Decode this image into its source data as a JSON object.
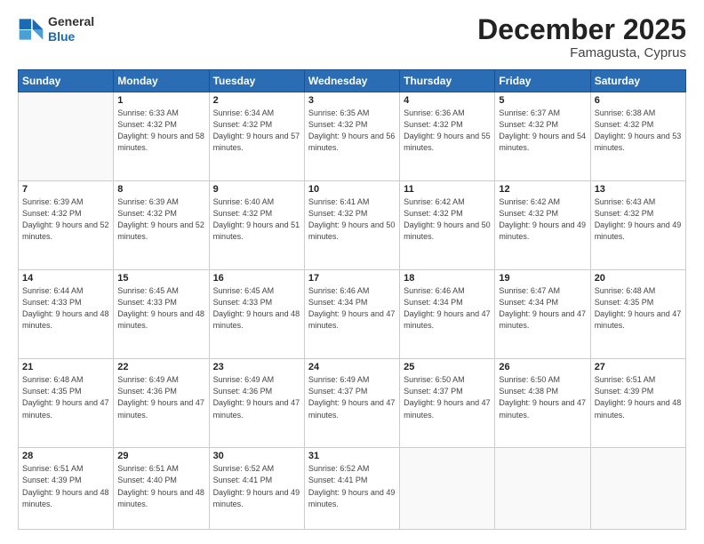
{
  "header": {
    "logo": {
      "general": "General",
      "blue": "Blue"
    },
    "title": "December 2025",
    "location": "Famagusta, Cyprus"
  },
  "calendar": {
    "days_of_week": [
      "Sunday",
      "Monday",
      "Tuesday",
      "Wednesday",
      "Thursday",
      "Friday",
      "Saturday"
    ],
    "weeks": [
      [
        {
          "num": "",
          "empty": true
        },
        {
          "num": "1",
          "sunrise": "6:33 AM",
          "sunset": "4:32 PM",
          "daylight": "9 hours and 58 minutes."
        },
        {
          "num": "2",
          "sunrise": "6:34 AM",
          "sunset": "4:32 PM",
          "daylight": "9 hours and 57 minutes."
        },
        {
          "num": "3",
          "sunrise": "6:35 AM",
          "sunset": "4:32 PM",
          "daylight": "9 hours and 56 minutes."
        },
        {
          "num": "4",
          "sunrise": "6:36 AM",
          "sunset": "4:32 PM",
          "daylight": "9 hours and 55 minutes."
        },
        {
          "num": "5",
          "sunrise": "6:37 AM",
          "sunset": "4:32 PM",
          "daylight": "9 hours and 54 minutes."
        },
        {
          "num": "6",
          "sunrise": "6:38 AM",
          "sunset": "4:32 PM",
          "daylight": "9 hours and 53 minutes."
        }
      ],
      [
        {
          "num": "7",
          "sunrise": "6:39 AM",
          "sunset": "4:32 PM",
          "daylight": "9 hours and 52 minutes."
        },
        {
          "num": "8",
          "sunrise": "6:39 AM",
          "sunset": "4:32 PM",
          "daylight": "9 hours and 52 minutes."
        },
        {
          "num": "9",
          "sunrise": "6:40 AM",
          "sunset": "4:32 PM",
          "daylight": "9 hours and 51 minutes."
        },
        {
          "num": "10",
          "sunrise": "6:41 AM",
          "sunset": "4:32 PM",
          "daylight": "9 hours and 50 minutes."
        },
        {
          "num": "11",
          "sunrise": "6:42 AM",
          "sunset": "4:32 PM",
          "daylight": "9 hours and 50 minutes."
        },
        {
          "num": "12",
          "sunrise": "6:42 AM",
          "sunset": "4:32 PM",
          "daylight": "9 hours and 49 minutes."
        },
        {
          "num": "13",
          "sunrise": "6:43 AM",
          "sunset": "4:32 PM",
          "daylight": "9 hours and 49 minutes."
        }
      ],
      [
        {
          "num": "14",
          "sunrise": "6:44 AM",
          "sunset": "4:33 PM",
          "daylight": "9 hours and 48 minutes."
        },
        {
          "num": "15",
          "sunrise": "6:45 AM",
          "sunset": "4:33 PM",
          "daylight": "9 hours and 48 minutes."
        },
        {
          "num": "16",
          "sunrise": "6:45 AM",
          "sunset": "4:33 PM",
          "daylight": "9 hours and 48 minutes."
        },
        {
          "num": "17",
          "sunrise": "6:46 AM",
          "sunset": "4:34 PM",
          "daylight": "9 hours and 47 minutes."
        },
        {
          "num": "18",
          "sunrise": "6:46 AM",
          "sunset": "4:34 PM",
          "daylight": "9 hours and 47 minutes."
        },
        {
          "num": "19",
          "sunrise": "6:47 AM",
          "sunset": "4:34 PM",
          "daylight": "9 hours and 47 minutes."
        },
        {
          "num": "20",
          "sunrise": "6:48 AM",
          "sunset": "4:35 PM",
          "daylight": "9 hours and 47 minutes."
        }
      ],
      [
        {
          "num": "21",
          "sunrise": "6:48 AM",
          "sunset": "4:35 PM",
          "daylight": "9 hours and 47 minutes."
        },
        {
          "num": "22",
          "sunrise": "6:49 AM",
          "sunset": "4:36 PM",
          "daylight": "9 hours and 47 minutes."
        },
        {
          "num": "23",
          "sunrise": "6:49 AM",
          "sunset": "4:36 PM",
          "daylight": "9 hours and 47 minutes."
        },
        {
          "num": "24",
          "sunrise": "6:49 AM",
          "sunset": "4:37 PM",
          "daylight": "9 hours and 47 minutes."
        },
        {
          "num": "25",
          "sunrise": "6:50 AM",
          "sunset": "4:37 PM",
          "daylight": "9 hours and 47 minutes."
        },
        {
          "num": "26",
          "sunrise": "6:50 AM",
          "sunset": "4:38 PM",
          "daylight": "9 hours and 47 minutes."
        },
        {
          "num": "27",
          "sunrise": "6:51 AM",
          "sunset": "4:39 PM",
          "daylight": "9 hours and 48 minutes."
        }
      ],
      [
        {
          "num": "28",
          "sunrise": "6:51 AM",
          "sunset": "4:39 PM",
          "daylight": "9 hours and 48 minutes."
        },
        {
          "num": "29",
          "sunrise": "6:51 AM",
          "sunset": "4:40 PM",
          "daylight": "9 hours and 48 minutes."
        },
        {
          "num": "30",
          "sunrise": "6:52 AM",
          "sunset": "4:41 PM",
          "daylight": "9 hours and 49 minutes."
        },
        {
          "num": "31",
          "sunrise": "6:52 AM",
          "sunset": "4:41 PM",
          "daylight": "9 hours and 49 minutes."
        },
        {
          "num": "",
          "empty": true
        },
        {
          "num": "",
          "empty": true
        },
        {
          "num": "",
          "empty": true
        }
      ]
    ]
  }
}
